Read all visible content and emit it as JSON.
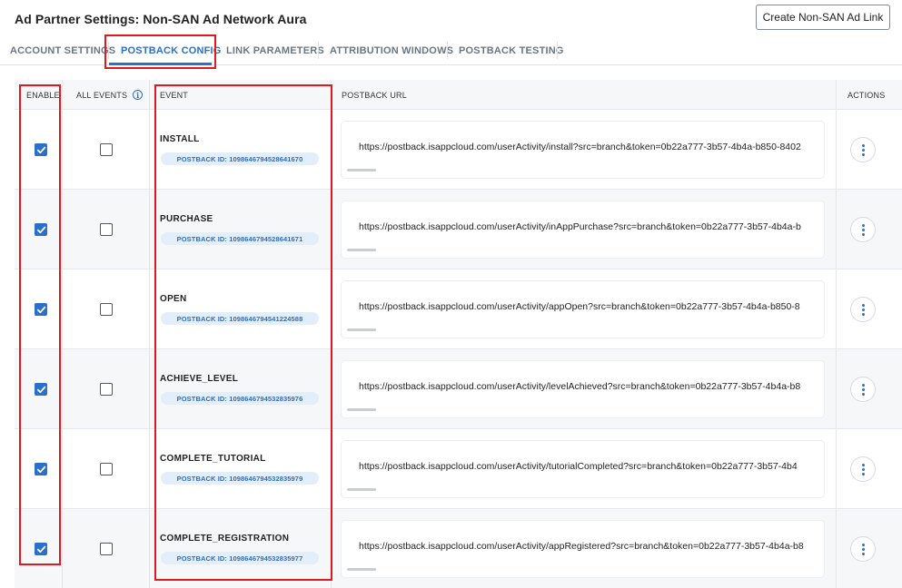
{
  "header": {
    "title": "Ad Partner Settings: Non-SAN Ad Network Aura",
    "create_button": "Create Non-SAN Ad Link"
  },
  "tabs": [
    {
      "label": "ACCOUNT SETTINGS",
      "active": false
    },
    {
      "label": "POSTBACK CONFIG",
      "active": true
    },
    {
      "label": "LINK PARAMETERS",
      "active": false
    },
    {
      "label": "ATTRIBUTION WINDOWS",
      "active": false
    },
    {
      "label": "POSTBACK TESTING",
      "active": false
    }
  ],
  "table": {
    "columns": {
      "enable": "ENABLE",
      "all_events": "ALL EVENTS",
      "event": "EVENT",
      "postback_url": "POSTBACK URL",
      "actions": "ACTIONS"
    },
    "rows": [
      {
        "enabled": true,
        "all_events": false,
        "event": "INSTALL",
        "postback_id": "POSTBACK ID: 1098646794528641670",
        "url": "https://postback.isappcloud.com/userActivity/install?src=branch&token=0b22a777-3b57-4b4a-b850-8402"
      },
      {
        "enabled": true,
        "all_events": false,
        "event": "PURCHASE",
        "postback_id": "POSTBACK ID: 1098646794528641671",
        "url": "https://postback.isappcloud.com/userActivity/inAppPurchase?src=branch&token=0b22a777-3b57-4b4a-b"
      },
      {
        "enabled": true,
        "all_events": false,
        "event": "OPEN",
        "postback_id": "POSTBACK ID: 1098646794541224588",
        "url": "https://postback.isappcloud.com/userActivity/appOpen?src=branch&token=0b22a777-3b57-4b4a-b850-8"
      },
      {
        "enabled": true,
        "all_events": false,
        "event": "ACHIEVE_LEVEL",
        "postback_id": "POSTBACK ID: 1098646794532835976",
        "url": "https://postback.isappcloud.com/userActivity/levelAchieved?src=branch&token=0b22a777-3b57-4b4a-b8"
      },
      {
        "enabled": true,
        "all_events": false,
        "event": "COMPLETE_TUTORIAL",
        "postback_id": "POSTBACK ID: 1098646794532835979",
        "url": "https://postback.isappcloud.com/userActivity/tutorialCompleted?src=branch&token=0b22a777-3b57-4b4"
      },
      {
        "enabled": true,
        "all_events": false,
        "event": "COMPLETE_REGISTRATION",
        "postback_id": "POSTBACK ID: 1098646794532835977",
        "url": "https://postback.isappcloud.com/userActivity/appRegistered?src=branch&token=0b22a777-3b57-4b4a-b8"
      }
    ]
  },
  "colors": {
    "accent": "#2a6fc9",
    "highlight": "#e0191f",
    "pill_bg": "#e3eefb"
  },
  "icons": {
    "info": "info-icon",
    "actions": "kebab-menu-icon",
    "checked": "checkmark-icon"
  }
}
